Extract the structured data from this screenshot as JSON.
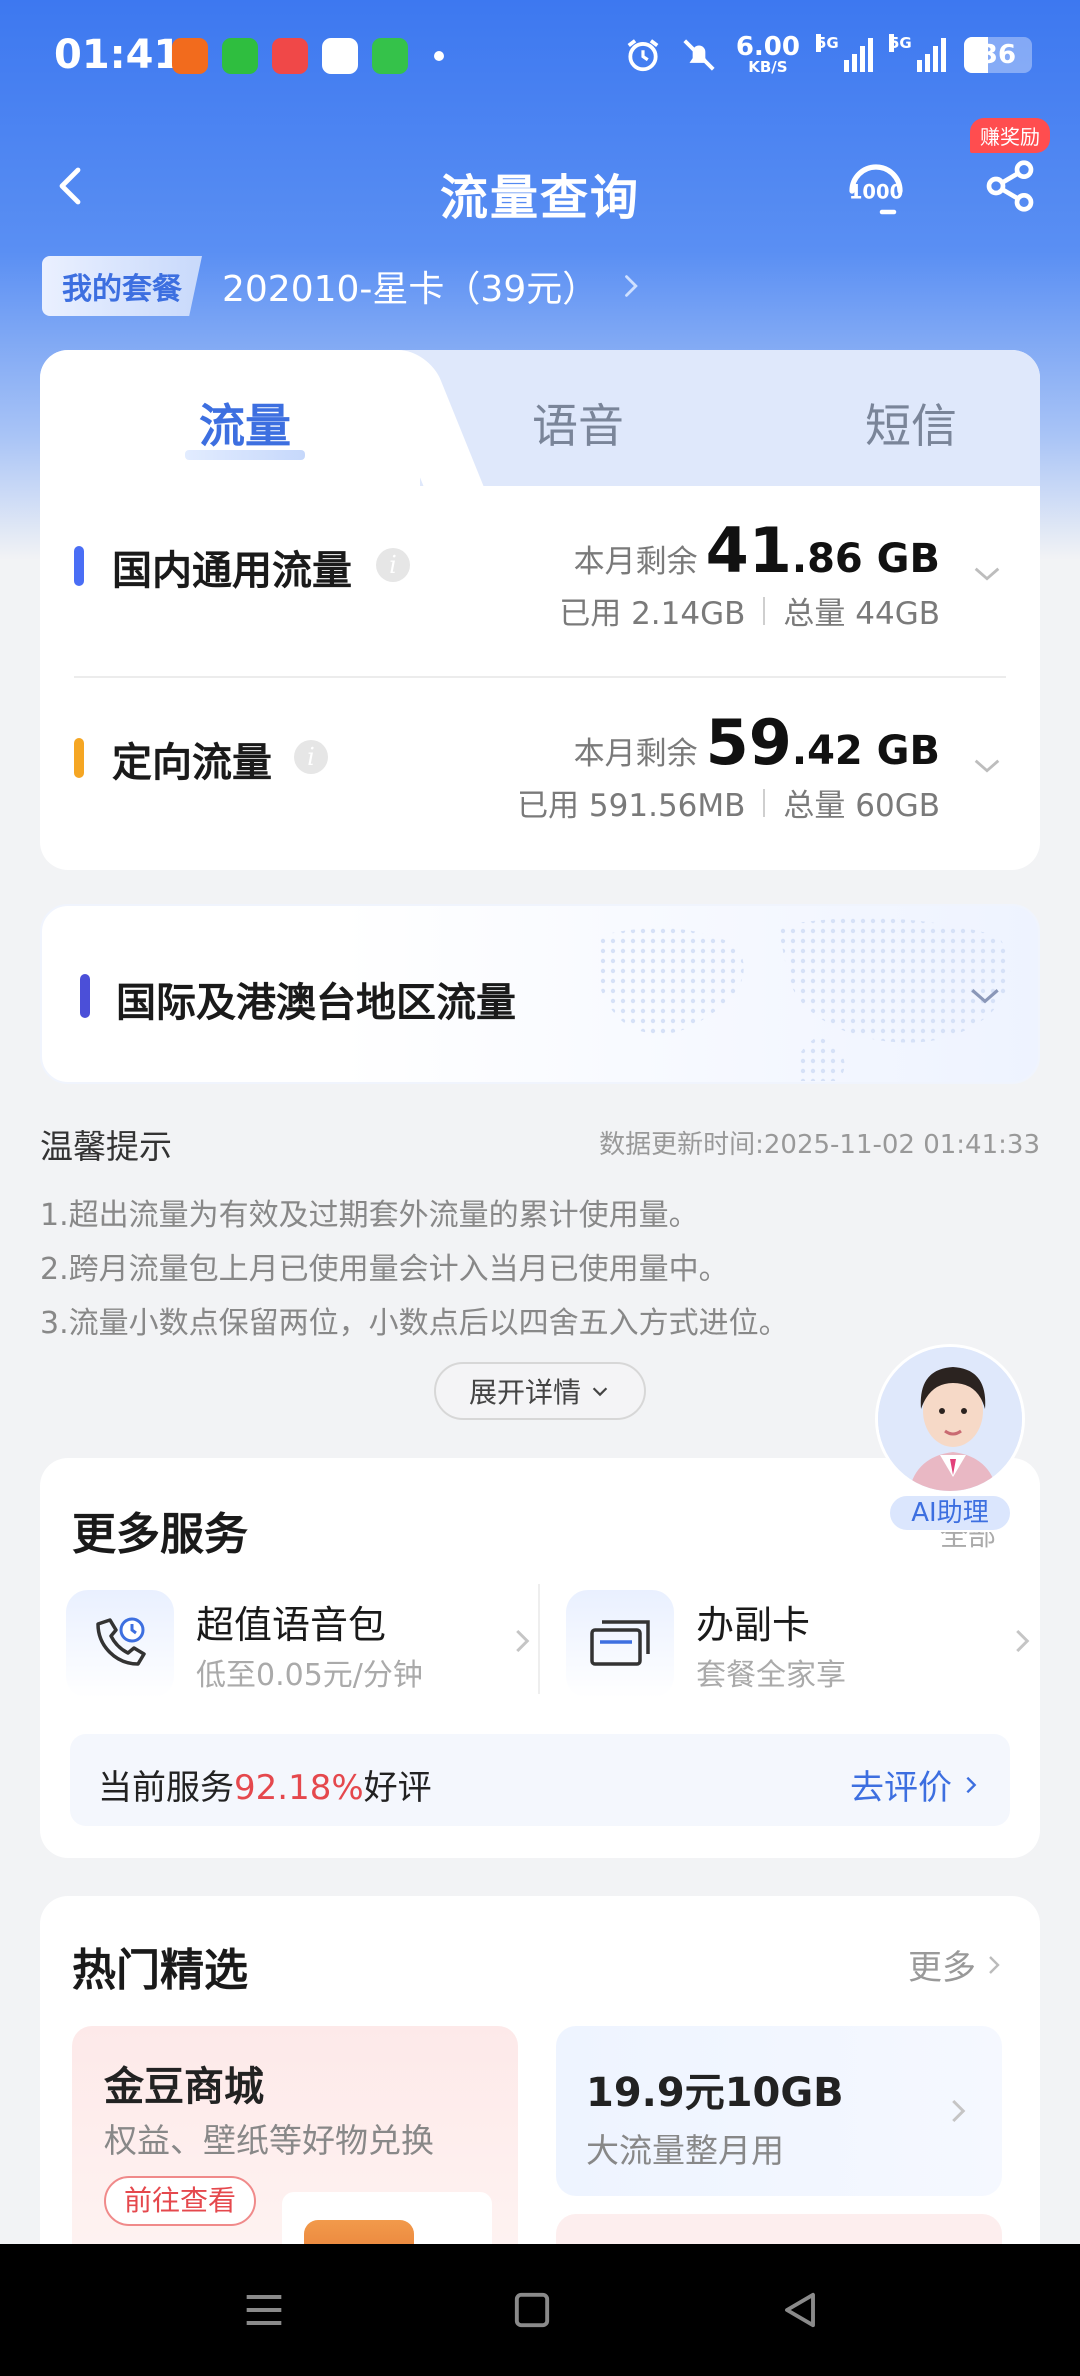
{
  "status_bar": {
    "time": "01:41",
    "net_speed_value": "6.00",
    "net_speed_unit": "KB/S",
    "sim1_label": "5G",
    "sim2_label": "5G",
    "battery": "36",
    "icons": [
      "app-store-icon",
      "iqiyi-icon",
      "game-icon",
      "china-mobile-icon",
      "message-icon",
      "alarm-icon",
      "mute-icon"
    ]
  },
  "header": {
    "title": "流量查询",
    "reward_badge": "赚奖励",
    "service_icon": "10000-hotline-icon"
  },
  "plan": {
    "badge": "我的套餐",
    "name": "202010-星卡（39元）"
  },
  "tabs": [
    {
      "label": "流量",
      "active": true
    },
    {
      "label": "语音",
      "active": false
    },
    {
      "label": "短信",
      "active": false
    }
  ],
  "usage": [
    {
      "name": "国内通用流量",
      "color": "#4a6ef5",
      "remain_label": "本月剩余",
      "remain_int": "41",
      "remain_dec": ".86 GB",
      "used": "已用 2.14GB",
      "total": "总量 44GB"
    },
    {
      "name": "定向流量",
      "color": "#f5a623",
      "remain_label": "本月剩余",
      "remain_int": "59",
      "remain_dec": ".42 GB",
      "used": "已用 591.56MB",
      "total": "总量 60GB"
    }
  ],
  "international": {
    "name": "国际及港澳台地区流量"
  },
  "tips": {
    "title": "温馨提示",
    "update_time": "数据更新时间:2025-11-02 01:41:33",
    "items": [
      "1.超出流量为有效及过期套外流量的累计使用量。",
      "2.跨月流量包上月已使用量会计入当月已使用量中。",
      "3.流量小数点保留两位，小数点后以四舍五入方式进位。"
    ],
    "expand_label": "展开详情"
  },
  "ai_assistant": {
    "label": "AI助理"
  },
  "more_services": {
    "title": "更多服务",
    "all_label": "全部",
    "items": [
      {
        "name": "超值语音包",
        "desc": "低至0.05元/分钟",
        "icon": "phone-clock-icon"
      },
      {
        "name": "办副卡",
        "desc": "套餐全家享",
        "icon": "cards-icon"
      }
    ],
    "rating_prefix": "当前服务",
    "rating_pct": "92.18%",
    "rating_suffix": "好评",
    "rating_link": "去评价"
  },
  "hot_picks": {
    "title": "热门精选",
    "more_label": "更多",
    "cards": [
      {
        "title": "金豆商城",
        "desc": "权益、壁纸等好物兑换",
        "button": "前往查看"
      },
      {
        "title": "19.9元10GB",
        "desc": "大流量整月用"
      }
    ]
  },
  "colors": {
    "brand_blue": "#3d6fe0",
    "accent_red": "#e5484d"
  }
}
